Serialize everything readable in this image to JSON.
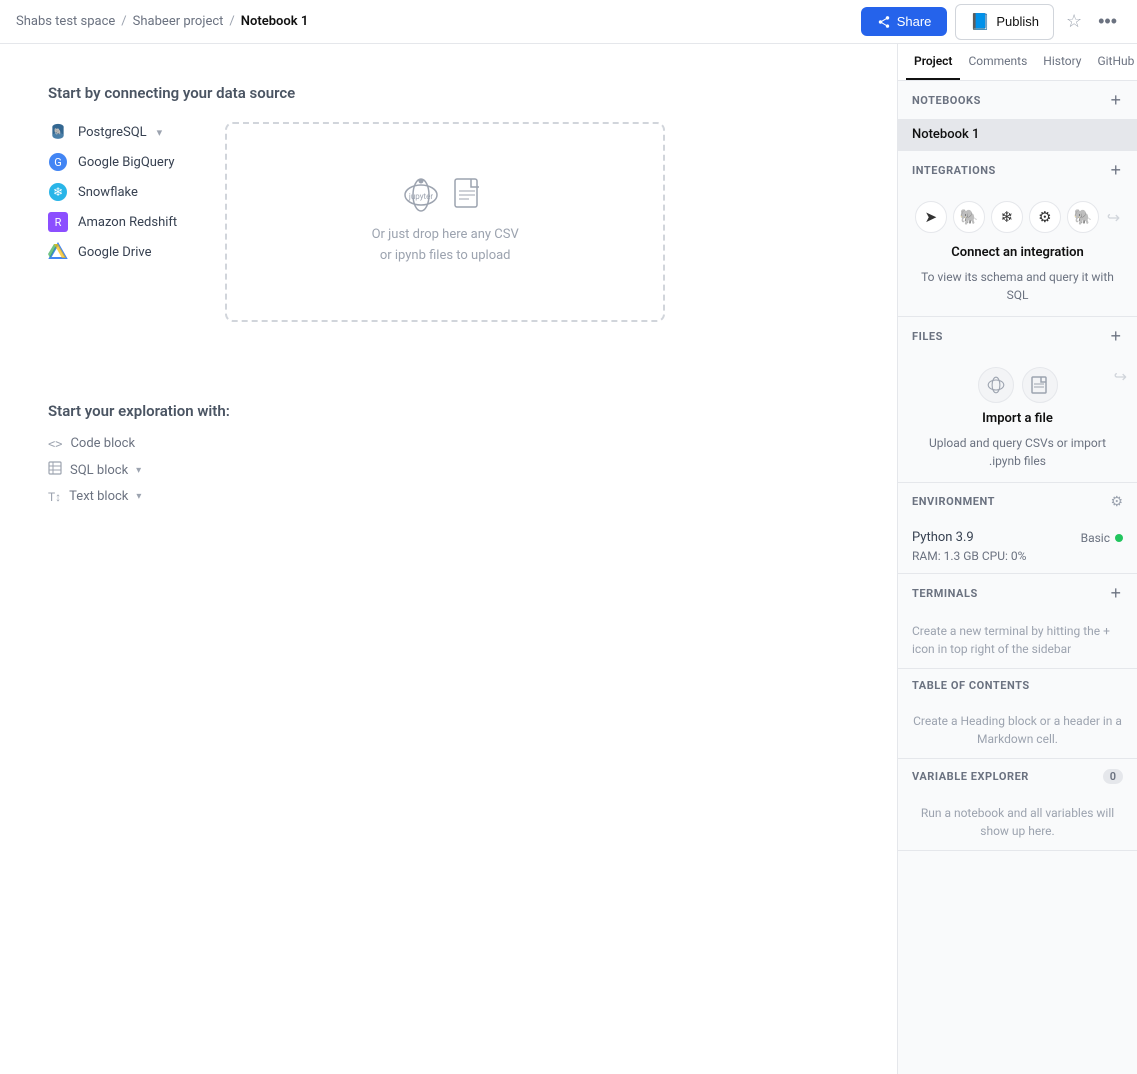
{
  "breadcrumb": {
    "workspace": "Shabs test space",
    "sep1": "/",
    "project": "Shabeer project",
    "sep2": "/",
    "current": "Notebook 1"
  },
  "topbar": {
    "share_label": "Share",
    "publish_label": "Publish",
    "star_icon": "☆",
    "dots_icon": "···"
  },
  "main": {
    "datasource_title": "Start by connecting your data source",
    "datasources": [
      {
        "name": "PostgreSQL",
        "icon": "🐘",
        "color": "#336791",
        "has_dropdown": true
      },
      {
        "name": "Google BigQuery",
        "icon": "🔵",
        "color": "#4285F4",
        "has_dropdown": false
      },
      {
        "name": "Snowflake",
        "icon": "❄️",
        "color": "#29B5E8",
        "has_dropdown": false
      },
      {
        "name": "Amazon Redshift",
        "icon": "🟥",
        "color": "#8C4FFF",
        "has_dropdown": false
      },
      {
        "name": "Google Drive",
        "icon": "△",
        "color": "#4285F4",
        "has_dropdown": false
      }
    ],
    "drop_text_line1": "Or just drop here any CSV",
    "drop_text_line2": "or ipynb files to upload",
    "explore_title": "Start your exploration with:",
    "explore_items": [
      {
        "label": "Code block",
        "icon": "<>",
        "has_arrow": false
      },
      {
        "label": "SQL block",
        "icon": "⊞",
        "has_arrow": true
      },
      {
        "label": "Text block",
        "icon": "T↕",
        "has_arrow": true
      }
    ]
  },
  "sidebar": {
    "tabs": [
      {
        "label": "Project",
        "active": true
      },
      {
        "label": "Comments",
        "active": false
      },
      {
        "label": "History",
        "active": false
      },
      {
        "label": "GitHub",
        "active": false
      }
    ],
    "notebooks_section": {
      "title": "NOTEBOOKS",
      "add_icon": "+",
      "items": [
        {
          "label": "Notebook 1",
          "active": true
        }
      ]
    },
    "integrations_section": {
      "title": "INTEGRATIONS",
      "add_icon": "+",
      "connect_title": "Connect an integration",
      "connect_desc": "To view its schema and query it with SQL"
    },
    "files_section": {
      "title": "FILES",
      "add_icon": "+",
      "import_title": "Import a file",
      "import_desc": "Upload and query CSVs or import .ipynb files"
    },
    "environment_section": {
      "title": "ENVIRONMENT",
      "python_version": "Python 3.9",
      "status_label": "Basic",
      "ram_cpu": "RAM: 1.3 GB  CPU: 0%"
    },
    "terminals_section": {
      "title": "TERMINALS",
      "add_icon": "+",
      "desc": "Create a new terminal by hitting the + icon in top right of the sidebar"
    },
    "toc_section": {
      "title": "TABLE OF CONTENTS",
      "desc": "Create a Heading block or a header in a Markdown cell."
    },
    "variable_explorer_section": {
      "title": "VARIABLE EXPLORER",
      "count": "0",
      "desc": "Run a notebook and all variables will show up here."
    }
  }
}
